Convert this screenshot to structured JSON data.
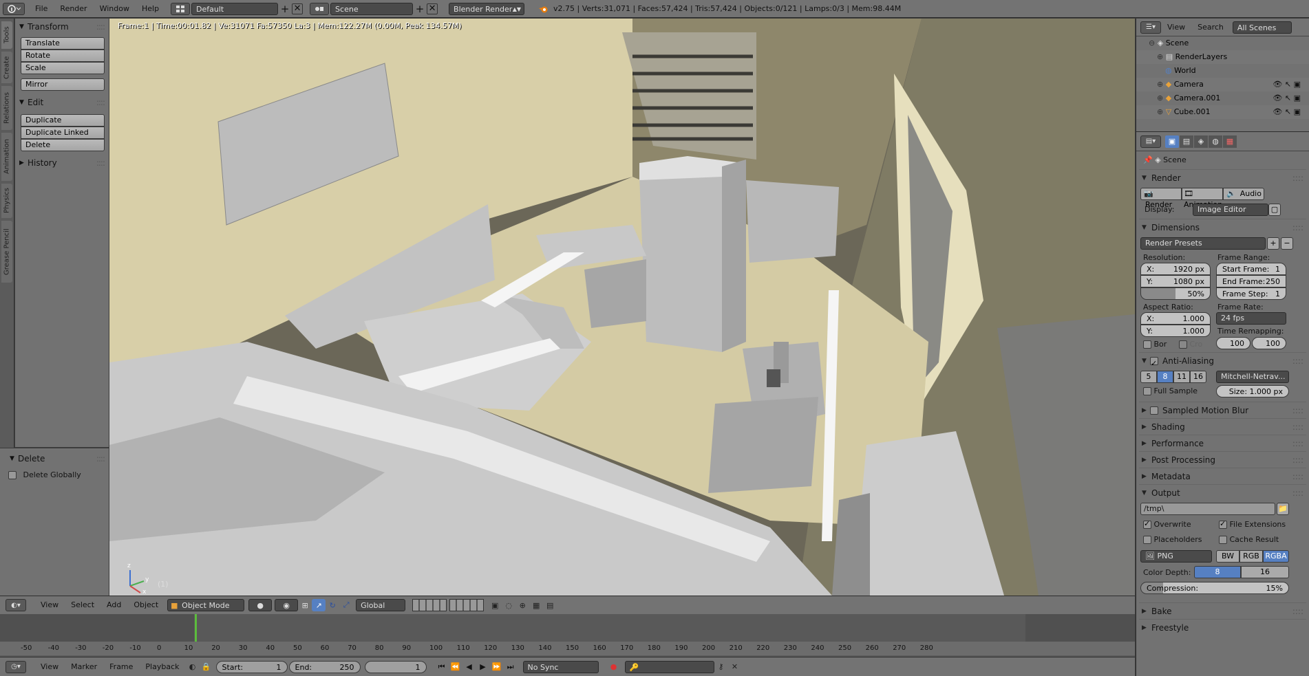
{
  "topbar": {
    "menus": [
      "File",
      "Render",
      "Window",
      "Help"
    ],
    "layout": "Default",
    "scene": "Scene",
    "engine": "Blender Render",
    "stats": "v2.75 | Verts:31,071 | Faces:57,424 | Tris:57,424 | Objects:0/121 | Lamps:0/3 | Mem:98.44M"
  },
  "left_tabs": [
    "Tools",
    "Create",
    "Relations",
    "Animation",
    "Physics",
    "Grease Pencil"
  ],
  "toolshelf": {
    "transform_title": "Transform",
    "transform_buttons": [
      "Translate",
      "Rotate",
      "Scale",
      "Mirror"
    ],
    "edit_title": "Edit",
    "edit_buttons": [
      "Duplicate",
      "Duplicate Linked",
      "Delete"
    ],
    "history_title": "History"
  },
  "redo_panel": {
    "title": "Delete",
    "option": "Delete Globally"
  },
  "viewport": {
    "info": "Frame:1 | Time:00:01.82 | Ve:31071 Fa:57350 La:3 | Mem:122.27M (0.00M, Peak 134.57M)",
    "frame_label": "(1)",
    "axis_z": "z",
    "axis_y": "y",
    "axis_x": "x"
  },
  "viewport_header": {
    "menus": [
      "View",
      "Select",
      "Add",
      "Object"
    ],
    "mode": "Object Mode",
    "orientation": "Global"
  },
  "timeline": {
    "ticks": [
      "-50",
      "-40",
      "-30",
      "-20",
      "-10",
      "0",
      "10",
      "20",
      "30",
      "40",
      "50",
      "60",
      "70",
      "80",
      "90",
      "100",
      "110",
      "120",
      "130",
      "140",
      "150",
      "160",
      "170",
      "180",
      "190",
      "200",
      "210",
      "220",
      "230",
      "240",
      "250",
      "260",
      "270",
      "280"
    ],
    "current_frame": 1
  },
  "timeline_header": {
    "menus": [
      "View",
      "Marker",
      "Frame",
      "Playback"
    ],
    "start_label": "Start:",
    "start_value": "1",
    "end_label": "End:",
    "end_value": "250",
    "current": "1",
    "sync": "No Sync"
  },
  "outliner": {
    "menus": [
      "View",
      "Search"
    ],
    "scope": "All Scenes",
    "rows": [
      "Scene",
      "RenderLayers",
      "World",
      "Camera",
      "Camera.001",
      "Cube.001"
    ]
  },
  "properties": {
    "context": "Scene",
    "render_title": "Render",
    "render_buttons": [
      "Render",
      "Animation",
      "Audio"
    ],
    "display_label": "Display:",
    "display_value": "Image Editor",
    "dimensions_title": "Dimensions",
    "presets": "Render Presets",
    "resolution_label": "Resolution:",
    "res_x": "X:",
    "res_x_val": "1920 px",
    "res_y": "Y:",
    "res_y_val": "1080 px",
    "res_pct": "50%",
    "frame_range_label": "Frame Range:",
    "start_frame": "Start Frame:",
    "start_frame_val": "1",
    "end_frame": "End Frame:",
    "end_frame_val": "250",
    "frame_step": "Frame Step:",
    "frame_step_val": "1",
    "aspect_label": "Aspect Ratio:",
    "aspect_x": "X:",
    "aspect_x_val": "1.000",
    "aspect_y": "Y:",
    "aspect_y_val": "1.000",
    "frame_rate_label": "Frame Rate:",
    "frame_rate": "24 fps",
    "time_remap_label": "Time Remapping:",
    "remap_old": "100",
    "remap_new": "100",
    "border": "Bor",
    "crop": "Cro",
    "aa_title": "Anti-Aliasing",
    "aa_samples": [
      "5",
      "8",
      "11",
      "16"
    ],
    "aa_filter": "Mitchell-Netrav...",
    "full_sample": "Full Sample",
    "aa_size": "Size: 1.000 px",
    "motion_blur": "Sampled Motion Blur",
    "collapsed": [
      "Shading",
      "Performance",
      "Post Processing",
      "Metadata"
    ],
    "output_title": "Output",
    "output_path": "/tmp\\",
    "overwrite": "Overwrite",
    "file_ext": "File Extensions",
    "placeholders": "Placeholders",
    "cache_result": "Cache Result",
    "format": "PNG",
    "color_modes": [
      "BW",
      "RGB",
      "RGBA"
    ],
    "color_depth_label": "Color Depth:",
    "depths": [
      "8",
      "16"
    ],
    "compression": "Compression:",
    "compression_val": "15%",
    "bake": "Bake",
    "freestyle": "Freestyle"
  },
  "colors": {
    "accent_blue": "#5680c2",
    "header_gray": "#737373",
    "panel_gray": "#727272",
    "current_frame_green": "#5cbe3c"
  }
}
